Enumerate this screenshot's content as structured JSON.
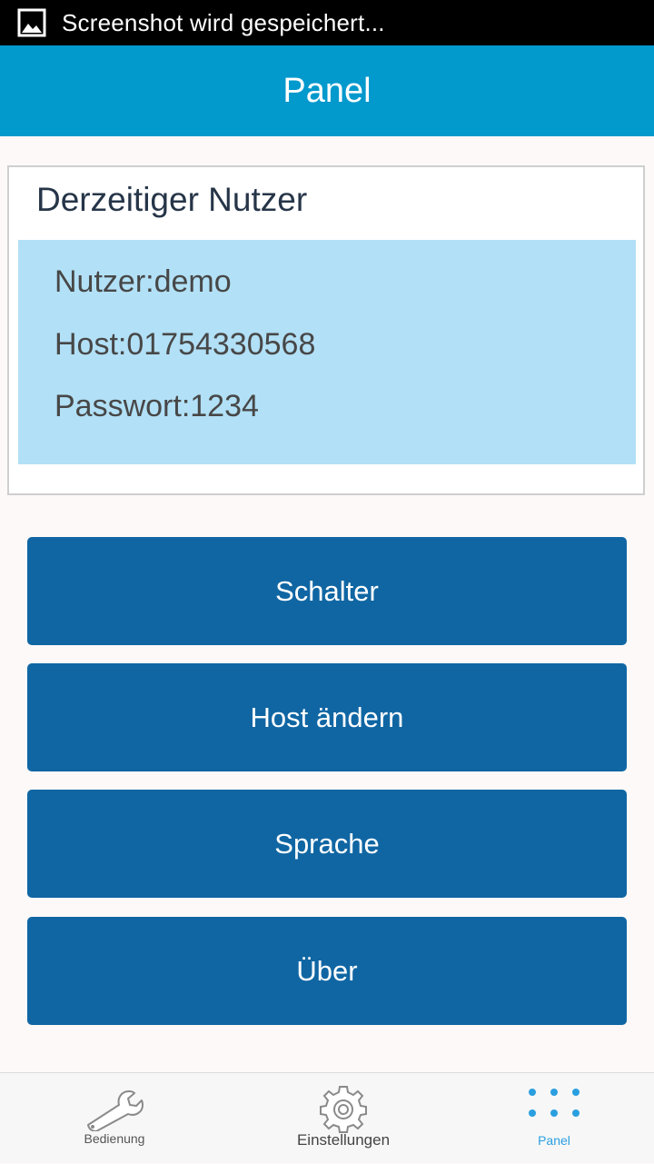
{
  "status_bar": {
    "icon": "image-icon",
    "text": "Screenshot wird gespeichert..."
  },
  "header": {
    "title": "Panel",
    "color": "#0299cd"
  },
  "user_card": {
    "title": "Derzeitiger Nutzer",
    "lines": [
      "Nutzer:demo",
      "Host:01754330568",
      "Passwort:1234"
    ],
    "info_bg_color": "#b2e0f6"
  },
  "actions": {
    "color": "#1066a3",
    "buttons": [
      {
        "label": "Schalter"
      },
      {
        "label": "Host ändern"
      },
      {
        "label": "Sprache"
      },
      {
        "label": "Über"
      }
    ]
  },
  "bottom_nav": {
    "active_color": "#2a9fe0",
    "items": [
      {
        "label": "Bedienung",
        "icon": "wrench-icon",
        "active": false
      },
      {
        "label": "Einstellungen",
        "icon": "gear-icon",
        "active": false
      },
      {
        "label": "Panel",
        "icon": "grid-dots-icon",
        "active": true
      }
    ]
  }
}
